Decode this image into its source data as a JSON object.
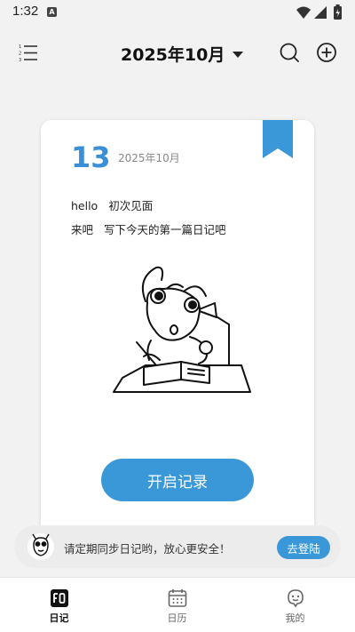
{
  "status_bar": {
    "time": "1:32",
    "notification_letter": "A"
  },
  "header": {
    "title": "2025年10月"
  },
  "card": {
    "day": "13",
    "month": "2025年10月",
    "lines": [
      {
        "key": "hello",
        "value": "初次见面"
      },
      {
        "key": "来吧",
        "value": "写下今天的第一篇日记吧"
      }
    ],
    "start_button": "开启记录"
  },
  "banner": {
    "text": "请定期同步日记哟，放心更安全！",
    "login_button": "去登陆"
  },
  "tabs": [
    {
      "label": "日记",
      "icon": "diary-icon",
      "active": true
    },
    {
      "label": "日历",
      "icon": "calendar-icon",
      "active": false
    },
    {
      "label": "我的",
      "icon": "profile-icon",
      "active": false
    }
  ],
  "colors": {
    "accent": "#3a98d8",
    "day_number": "#3a8fd6",
    "background": "#f2f2f2"
  }
}
